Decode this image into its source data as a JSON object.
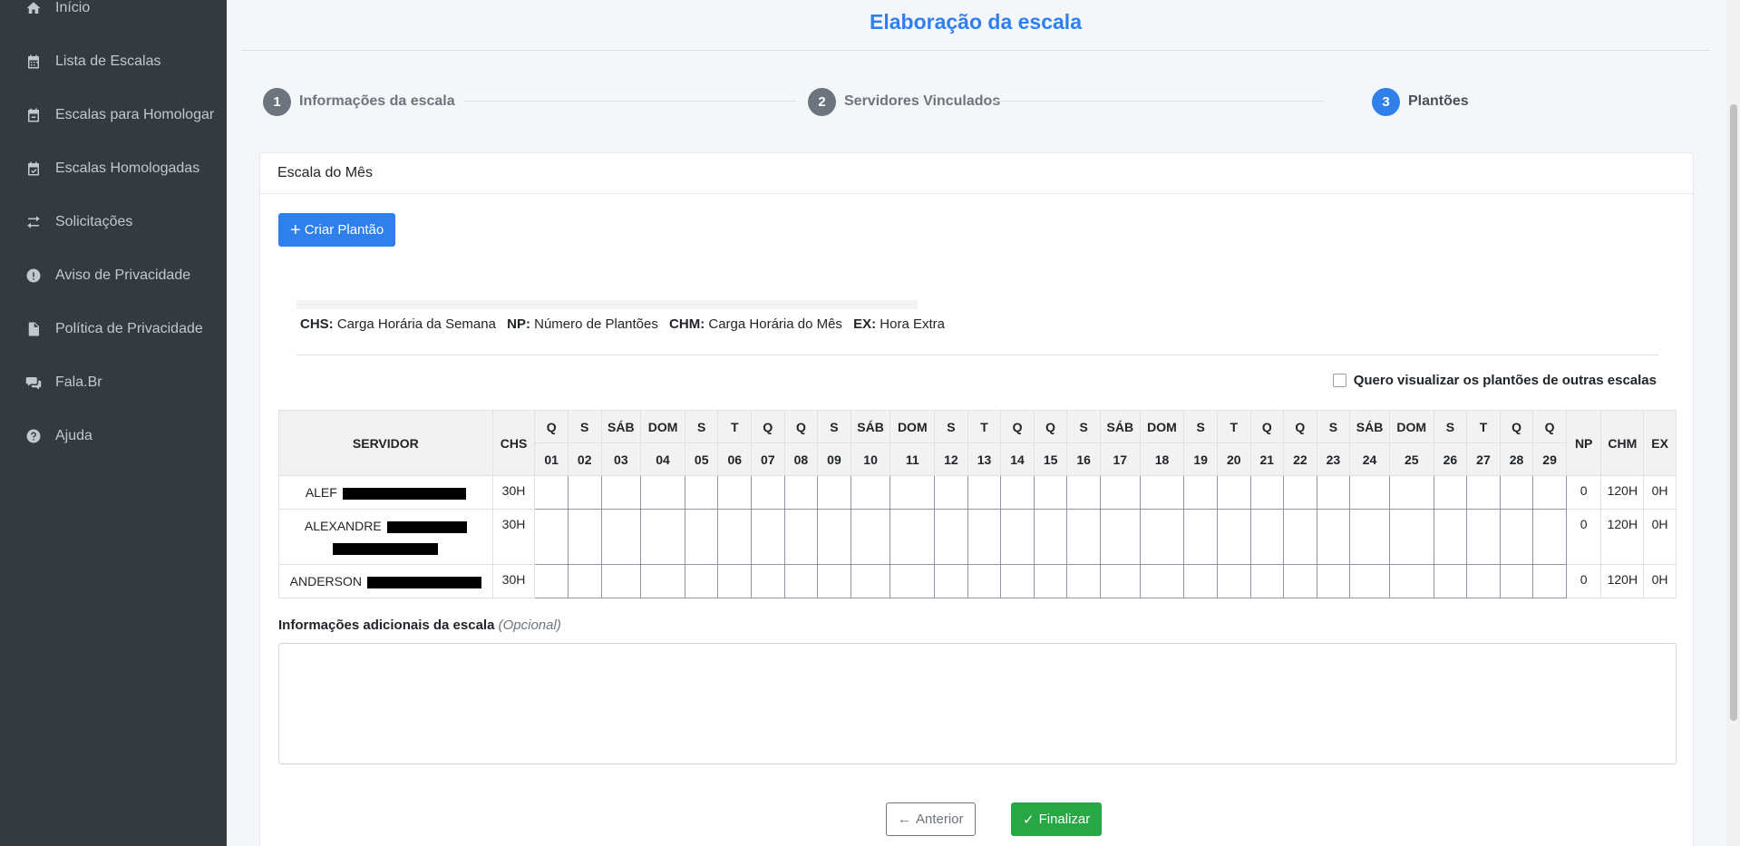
{
  "sidebar": {
    "items": [
      {
        "label": "Início",
        "icon": "home-icon"
      },
      {
        "label": "Lista de Escalas",
        "icon": "calendar-icon"
      },
      {
        "label": "Escalas para Homologar",
        "icon": "calendar-minus-icon"
      },
      {
        "label": "Escalas Homologadas",
        "icon": "calendar-check-icon"
      },
      {
        "label": "Solicitações",
        "icon": "exchange-icon"
      },
      {
        "label": "Aviso de Privacidade",
        "icon": "exclamation-circle-icon"
      },
      {
        "label": "Política de Privacidade",
        "icon": "file-icon"
      },
      {
        "label": "Fala.Br",
        "icon": "comments-icon"
      },
      {
        "label": "Ajuda",
        "icon": "question-circle-icon"
      }
    ]
  },
  "page": {
    "title": "Elaboração da escala"
  },
  "stepper": [
    {
      "num": "1",
      "label": "Informações da escala",
      "active": false
    },
    {
      "num": "2",
      "label": "Servidores Vinculados",
      "active": false
    },
    {
      "num": "3",
      "label": "Plantões",
      "active": true
    }
  ],
  "card": {
    "header": "Escala do Mês",
    "create_button": "Criar Plantão",
    "legend": [
      {
        "abbr": "CHS:",
        "text": "Carga Horária da Semana"
      },
      {
        "abbr": "NP:",
        "text": "Número de Plantões"
      },
      {
        "abbr": "CHM:",
        "text": "Carga Horária do Mês"
      },
      {
        "abbr": "EX:",
        "text": "Hora Extra"
      }
    ],
    "checkbox_label": "Quero visualizar os plantões de outras escalas",
    "checkbox_checked": false
  },
  "table": {
    "col_servidor": "SERVIDOR",
    "col_chs": "CHS",
    "col_np": "NP",
    "col_chm": "CHM",
    "col_ex": "EX",
    "days": [
      {
        "wd": "Q",
        "d": "01"
      },
      {
        "wd": "S",
        "d": "02"
      },
      {
        "wd": "SÁB",
        "d": "03"
      },
      {
        "wd": "DOM",
        "d": "04"
      },
      {
        "wd": "S",
        "d": "05"
      },
      {
        "wd": "T",
        "d": "06"
      },
      {
        "wd": "Q",
        "d": "07"
      },
      {
        "wd": "Q",
        "d": "08"
      },
      {
        "wd": "S",
        "d": "09"
      },
      {
        "wd": "SÁB",
        "d": "10"
      },
      {
        "wd": "DOM",
        "d": "11"
      },
      {
        "wd": "S",
        "d": "12"
      },
      {
        "wd": "T",
        "d": "13"
      },
      {
        "wd": "Q",
        "d": "14"
      },
      {
        "wd": "Q",
        "d": "15"
      },
      {
        "wd": "S",
        "d": "16"
      },
      {
        "wd": "SÁB",
        "d": "17"
      },
      {
        "wd": "DOM",
        "d": "18"
      },
      {
        "wd": "S",
        "d": "19"
      },
      {
        "wd": "T",
        "d": "20"
      },
      {
        "wd": "Q",
        "d": "21"
      },
      {
        "wd": "Q",
        "d": "22"
      },
      {
        "wd": "S",
        "d": "23"
      },
      {
        "wd": "SÁB",
        "d": "24"
      },
      {
        "wd": "DOM",
        "d": "25"
      },
      {
        "wd": "S",
        "d": "26"
      },
      {
        "wd": "T",
        "d": "27"
      },
      {
        "wd": "Q",
        "d": "28"
      },
      {
        "wd": "Q",
        "d": "29"
      }
    ],
    "rows": [
      {
        "name": "ALEF",
        "chs": "30H",
        "np": "0",
        "chm": "120H",
        "ex": "0H"
      },
      {
        "name": "ALEXANDRE",
        "chs": "30H",
        "np": "0",
        "chm": "120H",
        "ex": "0H"
      },
      {
        "name": "ANDERSON",
        "chs": "30H",
        "np": "0",
        "chm": "120H",
        "ex": "0H"
      }
    ]
  },
  "info": {
    "label": "Informações adicionais da escala",
    "optional": "(Opcional)",
    "value": ""
  },
  "footer": {
    "prev_label": "Anterior",
    "finish_label": "Finalizar"
  },
  "colors": {
    "primary": "#2f80ed",
    "success": "#28a745",
    "sidebar": "#343a40"
  }
}
